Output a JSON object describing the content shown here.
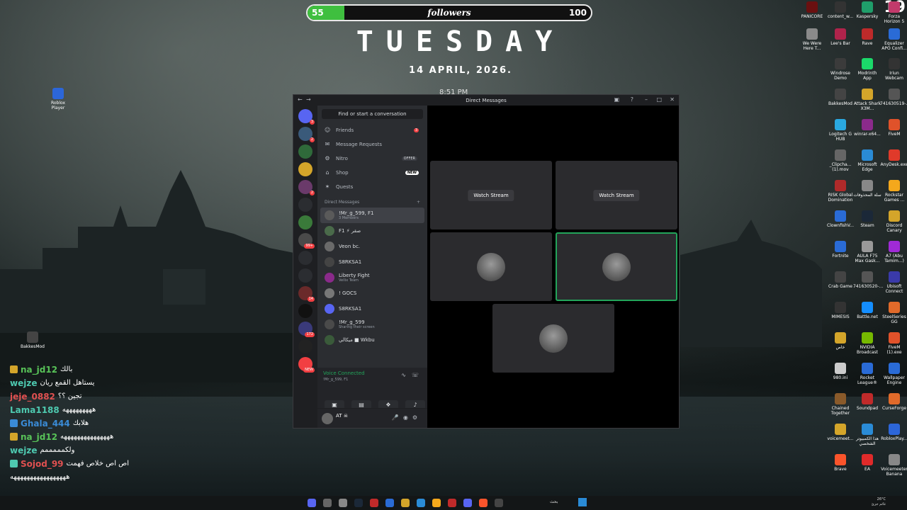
{
  "overlay": {
    "followers_min": "55",
    "followers_title": "followers",
    "followers_max": "100",
    "day": "TUESDAY",
    "date": "14 APRIL, 2026.",
    "time": "8:51 PM",
    "corner_number": "19"
  },
  "desktop_left_icons": [
    {
      "label": "Roblox Player",
      "color": "#2c66d9"
    },
    {
      "label": "BakkesMod",
      "color": "#444444"
    }
  ],
  "desktop_right_icons": [
    {
      "label": "PANICORE",
      "color": "#6a1010"
    },
    {
      "label": "content_w...",
      "color": "#333333"
    },
    {
      "label": "Kaspersky",
      "color": "#1f9e6a"
    },
    {
      "label": "Forza Horizon 5",
      "color": "#c23a6b"
    },
    {
      "label": "We Were Here T...",
      "color": "#8a8a8a"
    },
    {
      "label": "Lee's Bar",
      "color": "#b0234b"
    },
    {
      "label": "Rave",
      "color": "#bd2a2a"
    },
    {
      "label": "Equalizer APO Confi...",
      "color": "#2a6bd6"
    },
    {
      "label": "Windrose Demo",
      "color": "#3b3b3b"
    },
    {
      "label": "Modrinth App",
      "color": "#1bd96a"
    },
    {
      "label": "Iriun Webcam",
      "color": "#333333"
    },
    {
      "label": "BakkesMod",
      "color": "#444444"
    },
    {
      "label": "Attack Shark X3M...",
      "color": "#d4a52a"
    },
    {
      "label": "741630519-...",
      "color": "#555555"
    },
    {
      "label": "Logitech G HUB",
      "color": "#2aa8e0"
    },
    {
      "label": "winrar-x64...",
      "color": "#8b2a8b"
    },
    {
      "label": "FiveM",
      "color": "#e0522a"
    },
    {
      "label": "_Clipcha... (1).mov",
      "color": "#666666"
    },
    {
      "label": "Microsoft Edge",
      "color": "#2a8bd6"
    },
    {
      "label": "AnyDesk.exe",
      "color": "#e03a2a"
    },
    {
      "label": "RISK Global Domination",
      "color": "#b02a2a"
    },
    {
      "label": "سلة المحذوفات",
      "color": "#888888"
    },
    {
      "label": "Rockstar Games ...",
      "color": "#f4a81c"
    },
    {
      "label": "ClownfishV...",
      "color": "#2a6bd6"
    },
    {
      "label": "Steam",
      "color": "#1b2838"
    },
    {
      "label": "Discord Canary",
      "color": "#d4a52a"
    },
    {
      "label": "Fortnite",
      "color": "#2a6bd6"
    },
    {
      "label": "AULA F75 Max Gask...",
      "color": "#999999"
    },
    {
      "label": "A7 (Abu Tamim...)",
      "color": "#a02ad6"
    },
    {
      "label": "Crab Game",
      "color": "#444444"
    },
    {
      "label": "741630520-...",
      "color": "#555555"
    },
    {
      "label": "Ubisoft Connect",
      "color": "#3a3aaa"
    },
    {
      "label": "MIMESIS",
      "color": "#333333"
    },
    {
      "label": "Battle.net",
      "color": "#148eff"
    },
    {
      "label": "SteelSeries GG",
      "color": "#e06a2a"
    },
    {
      "label": "خاص",
      "color": "#d4a52a"
    },
    {
      "label": "NVIDIA Broadcast",
      "color": "#76b900"
    },
    {
      "label": "FiveM (1).exe",
      "color": "#e0522a"
    },
    {
      "label": "980.ini",
      "color": "#cccccc"
    },
    {
      "label": "Rocket League®",
      "color": "#2a6bd6"
    },
    {
      "label": "Wallpaper Engine",
      "color": "#2a6bd6"
    },
    {
      "label": "Chained Together",
      "color": "#8a5a2a"
    },
    {
      "label": "Soundpad",
      "color": "#c02a2a"
    },
    {
      "label": "CurseForge",
      "color": "#e06a2a"
    },
    {
      "label": "voicemeet...",
      "color": "#d4a52a"
    },
    {
      "label": "هذا الكمبيوتر الشخصي",
      "color": "#2a8bd6"
    },
    {
      "label": "RobloxPlay...",
      "color": "#2c66d9"
    },
    {
      "label": "Brave",
      "color": "#fb542b"
    },
    {
      "label": "EA",
      "color": "#e02a2a"
    },
    {
      "label": "Voicemeeter Banana",
      "color": "#888888"
    }
  ],
  "chat": [
    {
      "user": "na_jd12",
      "msg": "بالك",
      "color": "#58c358",
      "badge": "#d4a52a"
    },
    {
      "user": "wejze",
      "msg": "يستاهل القمع ريان",
      "color": "#4ec9b0",
      "badge": ""
    },
    {
      "user": "jeje_0882",
      "msg": "تجين ؟؟",
      "color": "#e05050",
      "badge": ""
    },
    {
      "user": "Lama1188",
      "msg": "هههههههههه",
      "color": "#4ec9b0",
      "badge": ""
    },
    {
      "user": "Ghala_444",
      "msg": "هلابك",
      "color": "#3a8bd6",
      "badge": "#3a8bd6"
    },
    {
      "user": "na_jd12",
      "msg": "هههههههههههههههه",
      "color": "#58c358",
      "badge": "#d4a52a"
    },
    {
      "user": "wejze",
      "msg": "ولكمممممم",
      "color": "#4ec9b0",
      "badge": ""
    },
    {
      "user": "Sojod_99",
      "msg": "اص اص خلاص فهمت",
      "color": "#e05050",
      "badge": "#4ec9b0"
    },
    {
      "user": "",
      "msg": "هههههههههههههههههه",
      "color": "#ffffff",
      "badge": ""
    }
  ],
  "discord": {
    "window_title": "Direct Messages",
    "search_placeholder": "Find or start a conversation",
    "nav": [
      {
        "label": "Friends",
        "icon": "friends-icon",
        "glyph": "☺",
        "badge": "3",
        "tag": ""
      },
      {
        "label": "Message Requests",
        "icon": "mail-icon",
        "glyph": "✉",
        "badge": "",
        "tag": ""
      },
      {
        "label": "Nitro",
        "icon": "nitro-icon",
        "glyph": "⚙",
        "badge": "",
        "tag": "OFFER"
      },
      {
        "label": "Shop",
        "icon": "shop-icon",
        "glyph": "⌂",
        "badge": "",
        "tag": "NEW"
      },
      {
        "label": "Quests",
        "icon": "quests-icon",
        "glyph": "✶",
        "badge": "",
        "tag": ""
      }
    ],
    "dm_header": "Direct Messages",
    "dm_add": "+",
    "dms": [
      {
        "name": "!Mr_g_599, F1",
        "sub": "3 Members",
        "color": "#5a5a5a"
      },
      {
        "name": "F1 ⚡ صقر",
        "sub": "",
        "color": "#4a6a4a"
      },
      {
        "name": "Veon bc.",
        "sub": "",
        "color": "#6a6a6a"
      },
      {
        "name": "S8RKSA1",
        "sub": "",
        "color": "#444444"
      },
      {
        "name": "Liberty Fight",
        "sub": "Vellix Team",
        "color": "#8a2a8a"
      },
      {
        "name": "! GOCS",
        "sub": "",
        "color": "#777777"
      },
      {
        "name": "S8RKSA1",
        "sub": "",
        "color": "#5865f2"
      },
      {
        "name": "!Mr_g_599",
        "sub": "Sharing their screen",
        "color": "#4a4a4a"
      },
      {
        "name": "ميكالي ■ Wkbu",
        "sub": "",
        "color": "#3a5a3a"
      }
    ],
    "guild_badges": [
      "3",
      "2",
      "",
      "",
      "2",
      "",
      "",
      "99+",
      "",
      "",
      "14",
      "",
      "172",
      "",
      "NEW"
    ],
    "voice": {
      "title": "Voice Connected",
      "sub": "!Mr_g_599, F1"
    },
    "user_name": "AT ☠",
    "tiles": [
      {
        "type": "button",
        "label": "Watch Stream",
        "active": false
      },
      {
        "type": "button",
        "label": "Watch Stream",
        "active": false
      },
      {
        "type": "avatar",
        "label": "",
        "active": false
      },
      {
        "type": "avatar",
        "label": "",
        "active": true
      },
      {
        "type": "avatar",
        "label": "",
        "active": false
      }
    ]
  },
  "taskbar": {
    "search_label": "بحث",
    "weather": "26°C",
    "weather_desc": "غائم جزئ"
  }
}
